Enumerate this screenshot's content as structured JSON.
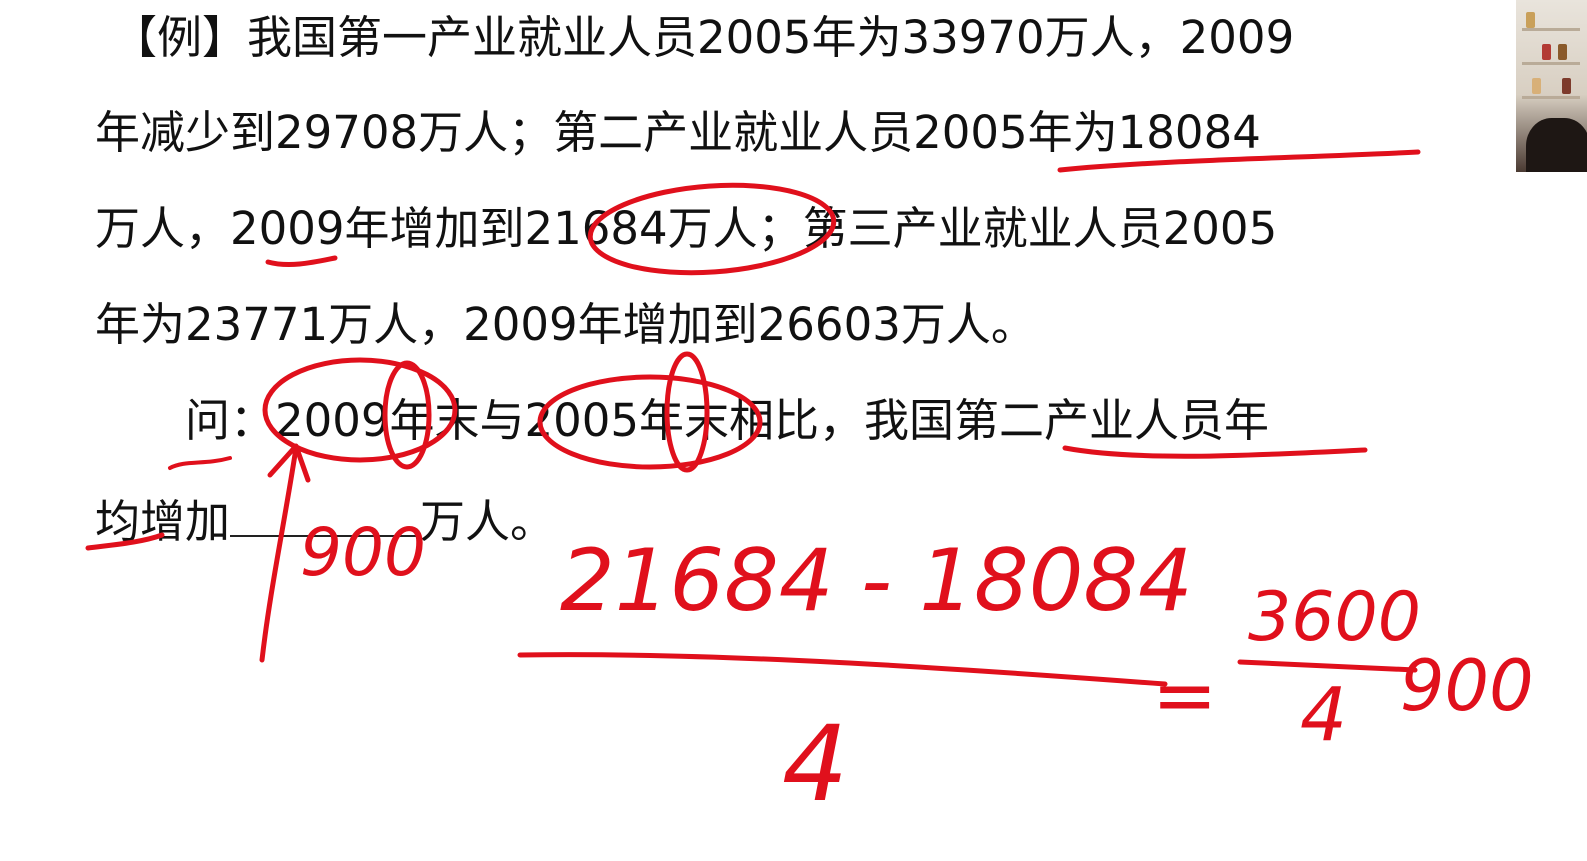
{
  "problem": {
    "line1": "【例】我国第一产业就业人员2005年为33970万人，2009",
    "line2": "年减少到29708万人；第二产业就业人员2005年为18084",
    "line3": "万人，2009年增加到21684万人；第三产业就业人员2005",
    "line4": "年为23771万人，2009年增加到26603万人。",
    "line5": "问：2009年末与2005年末相比，我国第二产业人员年",
    "line6_start": "均增加",
    "line6_end": "万人。"
  },
  "handwriting": {
    "answer": "900",
    "numerator": "21684 - 18084",
    "denominator": "4",
    "equals": "=",
    "fraction_top": "3600",
    "fraction_bottom": "4",
    "result": "900"
  },
  "colors": {
    "ink": "#e0101c",
    "text": "#111111",
    "background": "#ffffff"
  }
}
